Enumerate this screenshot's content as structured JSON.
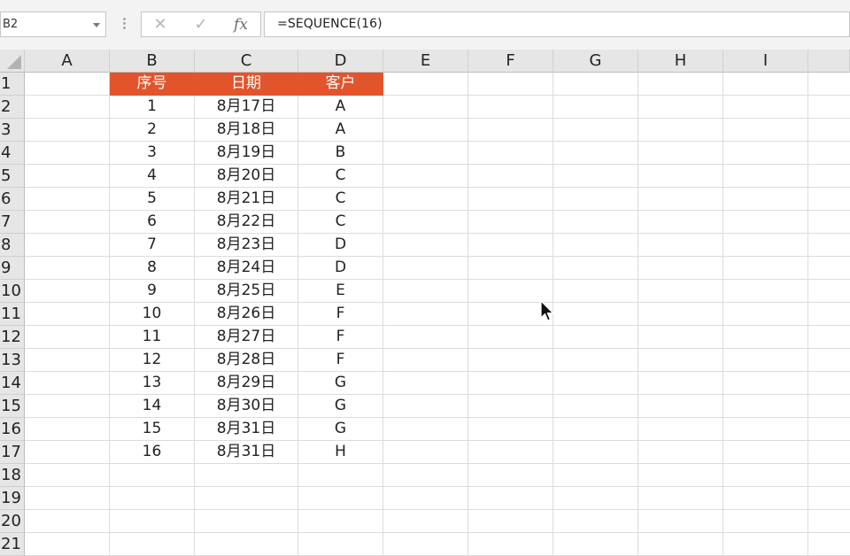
{
  "formula_bar": {
    "name_box": "B2",
    "cancel_icon": "✕",
    "enter_icon": "✓",
    "fx_label": "fx",
    "formula": "=SEQUENCE(16)"
  },
  "columns": [
    "A",
    "B",
    "C",
    "D",
    "E",
    "F",
    "G",
    "H",
    "I"
  ],
  "rows": [
    "1",
    "2",
    "3",
    "4",
    "5",
    "6",
    "7",
    "8",
    "9",
    "10",
    "11",
    "12",
    "13",
    "14",
    "15",
    "16",
    "17",
    "18",
    "19",
    "20",
    "21"
  ],
  "table": {
    "headers": [
      "序号",
      "日期",
      "客户"
    ],
    "rows": [
      [
        "1",
        "8月17日",
        "A"
      ],
      [
        "2",
        "8月18日",
        "A"
      ],
      [
        "3",
        "8月19日",
        "B"
      ],
      [
        "4",
        "8月20日",
        "C"
      ],
      [
        "5",
        "8月21日",
        "C"
      ],
      [
        "6",
        "8月22日",
        "C"
      ],
      [
        "7",
        "8月23日",
        "D"
      ],
      [
        "8",
        "8月24日",
        "D"
      ],
      [
        "9",
        "8月25日",
        "E"
      ],
      [
        "10",
        "8月26日",
        "F"
      ],
      [
        "11",
        "8月27日",
        "F"
      ],
      [
        "12",
        "8月28日",
        "F"
      ],
      [
        "13",
        "8月29日",
        "G"
      ],
      [
        "14",
        "8月30日",
        "G"
      ],
      [
        "15",
        "8月31日",
        "G"
      ],
      [
        "16",
        "8月31日",
        "H"
      ]
    ]
  },
  "colors": {
    "header_fill": "#e2542b",
    "header_text": "#ffffff"
  }
}
